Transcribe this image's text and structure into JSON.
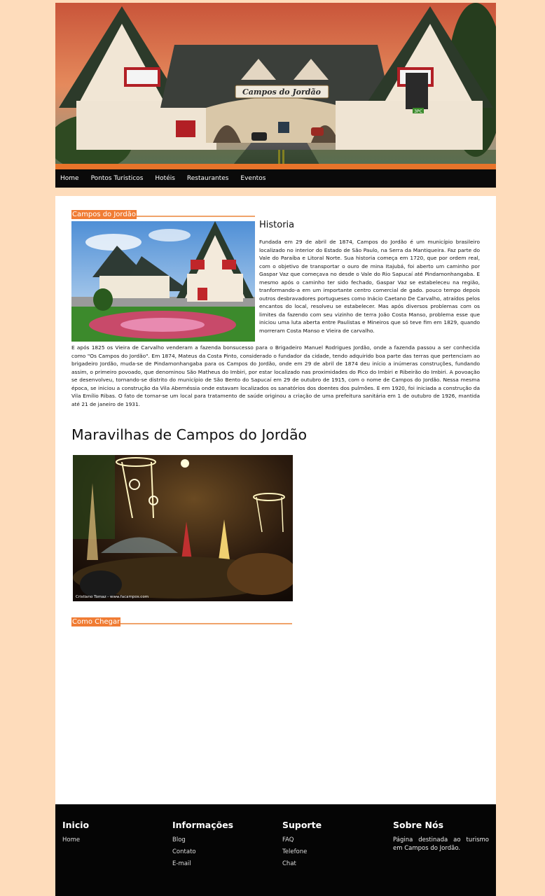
{
  "banner": {
    "sign_text": "Campos do Jordão",
    "sign_small": "3PC"
  },
  "nav": {
    "items": [
      "Home",
      "Pontos Turisticos",
      "Hotéis",
      "Restaurantes",
      "Eventos"
    ]
  },
  "section1": {
    "heading": "Campos do Jordão",
    "title": "Historia",
    "paragraph1": "Fundada em 29 de abril de 1874, Campos do Jordão é um município brasileiro localizado no interior do Estado de São Paulo, na Serra da Mantiqueira. Faz parte do Vale do Paraíba e Litoral Norte. Sua historia começa em 1720, que por ordem real, com o objetivo de transportar o ouro de mina Itajubá, foi aberto um caminho por Gaspar Vaz que começava no desde o Vale do Rio Sapucaí até Pindamonhangaba. E mesmo após o caminho ter sido fechado, Gaspar Vaz se estabeleceu na região, tranformando-a em um importante centro comercial de gado. pouco tempo depois outros desbravadores portugueses como Inácio Caetano De Carvalho, atraídos pelos encantos do local, resolveu se estabelecer. Mas após diversos problemas com os limites da fazendo com seu vizinho de terra João Costa Manso, problema esse que iniciou uma luta aberta entre Paulistas e Mineiros que só teve fim em 1829, quando morreram Costa Manso e Vieira de carvalho.",
    "paragraph2": "E após 1825 os Vieira de Carvalho venderam a fazenda bonsucesso para o Brigadeiro Manuel Rodrigues Jordão, onde a fazenda passou a ser conhecida como \"Os Campos do Jordão\". Em 1874, Mateus da Costa Pinto, considerado o fundador da cidade, tendo adquirido boa parte das terras que pertenciam ao brigadeiro Jordão, muda-se de Pindamonhangaba para os Campos do Jordão, onde em 29 de abril de 1874 deu início a inúmeras construções, fundando assim, o primeiro povoado, que denominou São Matheus do Imbiri, por estar localizado nas proximidades do Pico do Imbiri e Ribeirão do Imbiri. A povoação se desenvolveu, tornando-se distrito do município de São Bento do Sapucaí em 29 de outubro de 1915, com o nome de Campos do Jordão. Nessa mesma época, se iniciou a construção da Vila Abernéssia onde estavam localizados os sanatórios dos doentes dos pulmões. E em 1920, foi iniciada a construção da Vila Emílio Ribas. O fato de tornar-se um local para tratamento de saúde originou a criação de uma prefeitura sanitária em 1 de outubro de 1926, mantida até 21 de janeiro de 1931."
  },
  "section2": {
    "title": "Maravilhas de Campos do Jordão",
    "photo_credit": "Cristiano Tomaz - www.facampos.com"
  },
  "section3": {
    "heading": "Como Chegar"
  },
  "footer": {
    "col1": {
      "title": "Inicio",
      "links": [
        "Home"
      ]
    },
    "col2": {
      "title": "Informações",
      "links": [
        "Blog",
        "Contato",
        "E-mail"
      ]
    },
    "col3": {
      "title": "Suporte",
      "links": [
        "FAQ",
        "Telefone",
        "Chat"
      ]
    },
    "col4": {
      "title": "Sobre Nós",
      "text": "Página destinada ao turismo em Campos do Jordão."
    }
  },
  "colors": {
    "page_bg": "#fedcbb",
    "accent": "#f07c34",
    "nav_bg": "#0a0a0a",
    "footer_bg": "#050505"
  }
}
